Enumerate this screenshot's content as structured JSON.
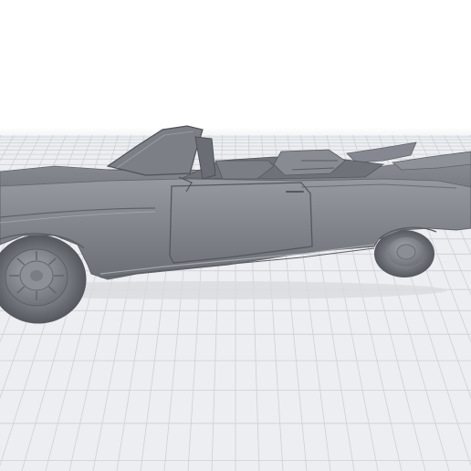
{
  "viewport": {
    "background_color": "#ffffff",
    "floor_color": "#eceef1",
    "grid_line_color": "#c9ccd3",
    "model_color": "#8a8d93"
  },
  "model": {
    "subject": "convertible-car-3d-model",
    "icon": "car-icon"
  }
}
